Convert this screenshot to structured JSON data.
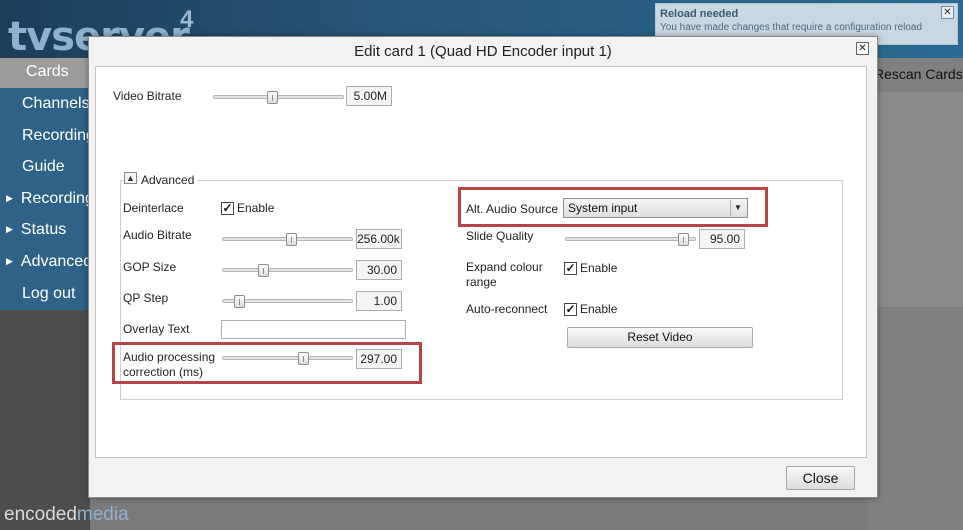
{
  "app": {
    "logo_text": "tvserver",
    "logo_version": "4",
    "nav_active": "Cards",
    "nav_items": [
      {
        "label": "Channels"
      },
      {
        "label": "Recordings"
      },
      {
        "label": "Guide"
      },
      {
        "label": "Recordings"
      },
      {
        "label": "Status"
      },
      {
        "label": "Advanced"
      },
      {
        "label": "Log out"
      }
    ],
    "rescan_label": "Rescan Cards",
    "footer_brand_a": "encoded",
    "footer_brand_b": "media"
  },
  "notification": {
    "title": "Reload needed",
    "message": "You have made changes that require a configuration reload"
  },
  "dialog": {
    "title": "Edit card 1 (Quad HD Encoder input 1)",
    "close_button": "Close",
    "video_bitrate": {
      "label": "Video Bitrate",
      "value": "5.00M",
      "level": 0.45
    },
    "advanced_label": "Advanced",
    "deinterlace": {
      "label": "Deinterlace",
      "checkbox_label": "Enable",
      "checked": true
    },
    "audio_bitrate": {
      "label": "Audio Bitrate",
      "value": "256.00k",
      "level": 0.53
    },
    "gop_size": {
      "label": "GOP Size",
      "value": "30.00",
      "level": 0.3
    },
    "qp_step": {
      "label": "QP Step",
      "value": "1.00",
      "level": 0.1
    },
    "overlay_text": {
      "label": "Overlay Text",
      "value": ""
    },
    "audio_processing": {
      "label_line1": "Audio processing",
      "label_line2": "correction (ms)",
      "value": "297.00",
      "level": 0.63
    },
    "alt_audio_source": {
      "label": "Alt. Audio Source",
      "selected": "System input"
    },
    "slide_quality": {
      "label": "Slide Quality",
      "value": "95.00",
      "level": 0.94
    },
    "expand_colour": {
      "label_line1": "Expand colour",
      "label_line2": "range",
      "checkbox_label": "Enable",
      "checked": true
    },
    "auto_reconnect": {
      "label": "Auto-reconnect",
      "checkbox_label": "Enable",
      "checked": true
    },
    "reset_video": "Reset Video"
  },
  "colors": {
    "highlight": "#b54545",
    "sidebar": "#2f6287",
    "header": "#27557a"
  }
}
